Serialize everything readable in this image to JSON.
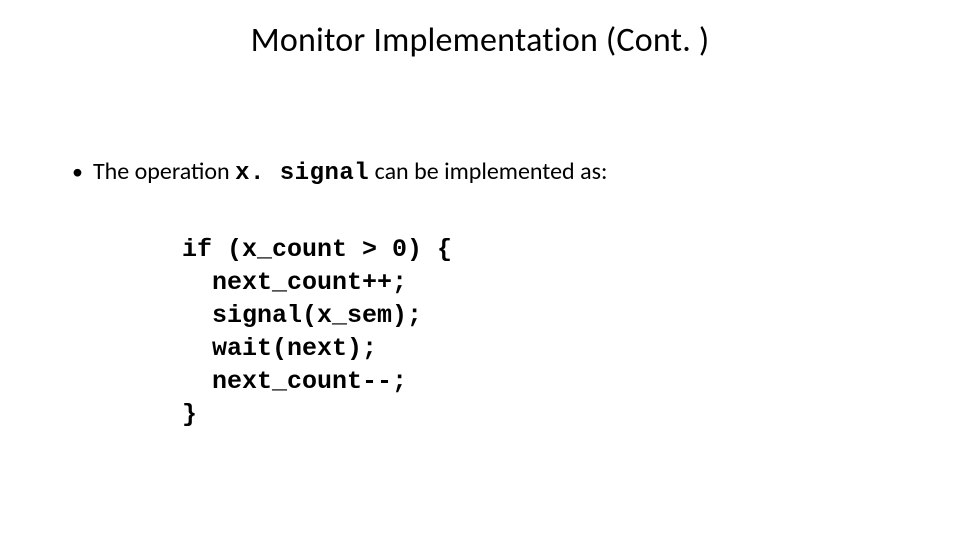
{
  "slide": {
    "title": "Monitor Implementation (Cont. )",
    "bullet": {
      "pre": "The operation ",
      "code": "x. signal",
      "post": " can be implemented as:"
    },
    "code": "if (x_count > 0) {\n  next_count++;\n  signal(x_sem);\n  wait(next);\n  next_count--;\n}"
  }
}
